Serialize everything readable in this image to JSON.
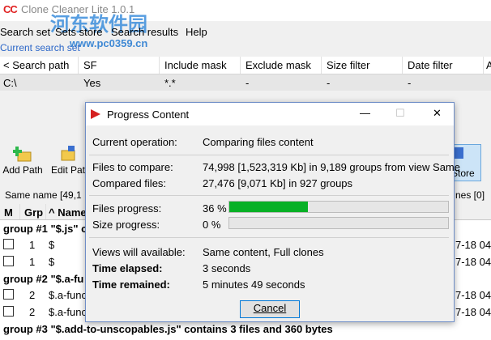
{
  "window": {
    "app_icon": "CC",
    "title": "Clone Cleaner Lite 1.0.1"
  },
  "watermark": {
    "cn": "河东软件园",
    "url": "www.pc0359.cn"
  },
  "menu": [
    "Search set",
    "Sets store",
    "Search results",
    "Help"
  ],
  "current_search_set": "Current search set",
  "search_grid": {
    "columns": [
      "< Search path",
      "SF",
      "Include mask",
      "Exclude mask",
      "Size filter",
      "Date filter",
      "A"
    ],
    "rows": [
      [
        "C:\\",
        "Yes",
        "*.*",
        "-",
        "-",
        "-",
        ""
      ]
    ]
  },
  "toolbar": {
    "add_path": "Add Path",
    "edit_path": "Edit Pat",
    "store": "Store"
  },
  "stats": {
    "left": "Same name [49,1",
    "right": "nes [0]"
  },
  "results_grid": {
    "columns": [
      "M",
      "Grp",
      "^ Name"
    ],
    "groups": [
      {
        "label": "group #1 \"$.js\" c",
        "rows": [
          {
            "grp": "1",
            "name": "$",
            "date": "7-18 04:"
          },
          {
            "grp": "1",
            "name": "$",
            "date": "7-18 04:"
          }
        ]
      },
      {
        "label": "group #2 \"$.a-fu",
        "rows": [
          {
            "grp": "2",
            "name": "$.a-func",
            "date": "7-18 04:"
          },
          {
            "grp": "2",
            "name": "$.a-func",
            "date": "7-18 04:"
          }
        ]
      },
      {
        "label": "group #3 \"$.add-to-unscopables.js\" contains 3 files and 360 bytes",
        "rows": []
      }
    ]
  },
  "dialog": {
    "title": "Progress Content",
    "current_operation_label": "Current operation:",
    "current_operation": "Comparing files content",
    "files_to_compare_label": "Files to compare:",
    "files_to_compare": "74,998 [1,523,319 Kb] in 9,189 groups from view Same",
    "compared_files_label": "Compared files:",
    "compared_files": "27,476 [9,071 Kb] in 927 groups",
    "files_progress_label": "Files progress:",
    "files_progress": "36 %",
    "files_progress_value": 36,
    "size_progress_label": "Size progress:",
    "size_progress": "0 %",
    "size_progress_value": 0,
    "views_label": "Views will available:",
    "views": "Same content, Full clones",
    "time_elapsed_label": "Time elapsed:",
    "time_elapsed": "3 seconds",
    "time_remained_label": "Time remained:",
    "time_remained": "5 minutes 49 seconds",
    "cancel": "Cancel"
  },
  "colors": {
    "accent": "#0078d7",
    "progress": "#06b025",
    "flag": "#d52020"
  }
}
